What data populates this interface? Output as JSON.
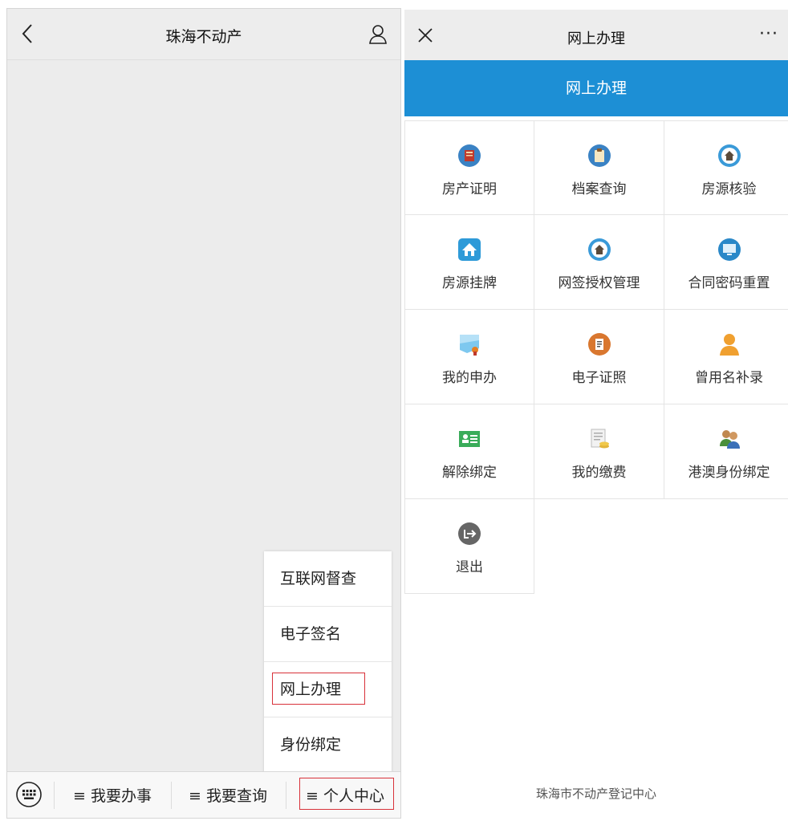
{
  "left": {
    "title": "珠海不动产",
    "popup_items": [
      "互联网督查",
      "电子签名",
      "网上办理",
      "身份绑定"
    ],
    "menu": [
      "≡ 我要办事",
      "≡ 我要查询",
      "≡ 个人中心"
    ]
  },
  "right": {
    "title": "网上办理",
    "more": "···",
    "banner": "网上办理",
    "grid": [
      {
        "label": "房产证明",
        "icon": "book-icon"
      },
      {
        "label": "档案查询",
        "icon": "clipboard-icon"
      },
      {
        "label": "房源核验",
        "icon": "house-icon"
      },
      {
        "label": "房源挂牌",
        "icon": "house-listing-icon"
      },
      {
        "label": "网签授权管理",
        "icon": "house-icon"
      },
      {
        "label": "合同密码重置",
        "icon": "monitor-icon"
      },
      {
        "label": "我的申办",
        "icon": "certificate-icon"
      },
      {
        "label": "电子证照",
        "icon": "document-icon"
      },
      {
        "label": "曾用名补录",
        "icon": "user-icon"
      },
      {
        "label": "解除绑定",
        "icon": "id-card-icon"
      },
      {
        "label": "我的缴费",
        "icon": "payment-icon"
      },
      {
        "label": "港澳身份绑定",
        "icon": "people-icon"
      },
      {
        "label": "退出",
        "icon": "exit-icon"
      }
    ],
    "footer": "珠海市不动产登记中心"
  },
  "colors": {
    "banner": "#1d8fd5",
    "highlight_box": "#d8323a"
  }
}
